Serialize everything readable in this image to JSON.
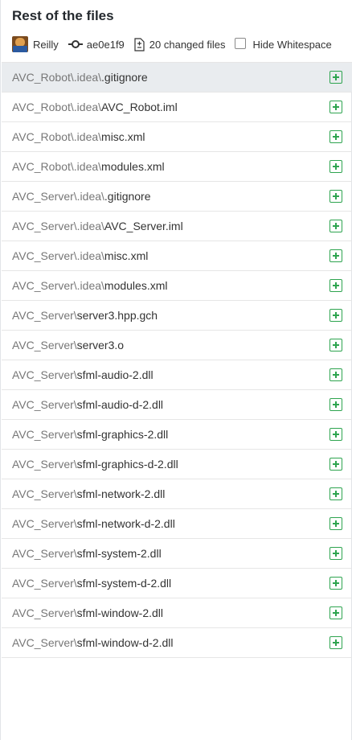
{
  "header": {
    "title": "Rest of the files",
    "author": "Reilly",
    "commit": "ae0e1f9",
    "changed_files": "20 changed files",
    "hide_whitespace_label": "Hide Whitespace"
  },
  "files": [
    {
      "dir": "AVC_Robot\\.idea\\",
      "name": ".gitignore",
      "selected": true
    },
    {
      "dir": "AVC_Robot\\.idea\\",
      "name": "AVC_Robot.iml"
    },
    {
      "dir": "AVC_Robot\\.idea\\",
      "name": "misc.xml"
    },
    {
      "dir": "AVC_Robot\\.idea\\",
      "name": "modules.xml"
    },
    {
      "dir": "AVC_Server\\.idea\\",
      "name": ".gitignore"
    },
    {
      "dir": "AVC_Server\\.idea\\",
      "name": "AVC_Server.iml"
    },
    {
      "dir": "AVC_Server\\.idea\\",
      "name": "misc.xml"
    },
    {
      "dir": "AVC_Server\\.idea\\",
      "name": "modules.xml"
    },
    {
      "dir": "AVC_Server\\",
      "name": "server3.hpp.gch"
    },
    {
      "dir": "AVC_Server\\",
      "name": "server3.o"
    },
    {
      "dir": "AVC_Server\\",
      "name": "sfml-audio-2.dll"
    },
    {
      "dir": "AVC_Server\\",
      "name": "sfml-audio-d-2.dll"
    },
    {
      "dir": "AVC_Server\\",
      "name": "sfml-graphics-2.dll"
    },
    {
      "dir": "AVC_Server\\",
      "name": "sfml-graphics-d-2.dll"
    },
    {
      "dir": "AVC_Server\\",
      "name": "sfml-network-2.dll"
    },
    {
      "dir": "AVC_Server\\",
      "name": "sfml-network-d-2.dll"
    },
    {
      "dir": "AVC_Server\\",
      "name": "sfml-system-2.dll"
    },
    {
      "dir": "AVC_Server\\",
      "name": "sfml-system-d-2.dll"
    },
    {
      "dir": "AVC_Server\\",
      "name": "sfml-window-2.dll"
    },
    {
      "dir": "AVC_Server\\",
      "name": "sfml-window-d-2.dll"
    }
  ],
  "file_status_icon": "added-icon",
  "colors": {
    "added": "#2ea44f",
    "selected_row": "#e9ecef"
  }
}
